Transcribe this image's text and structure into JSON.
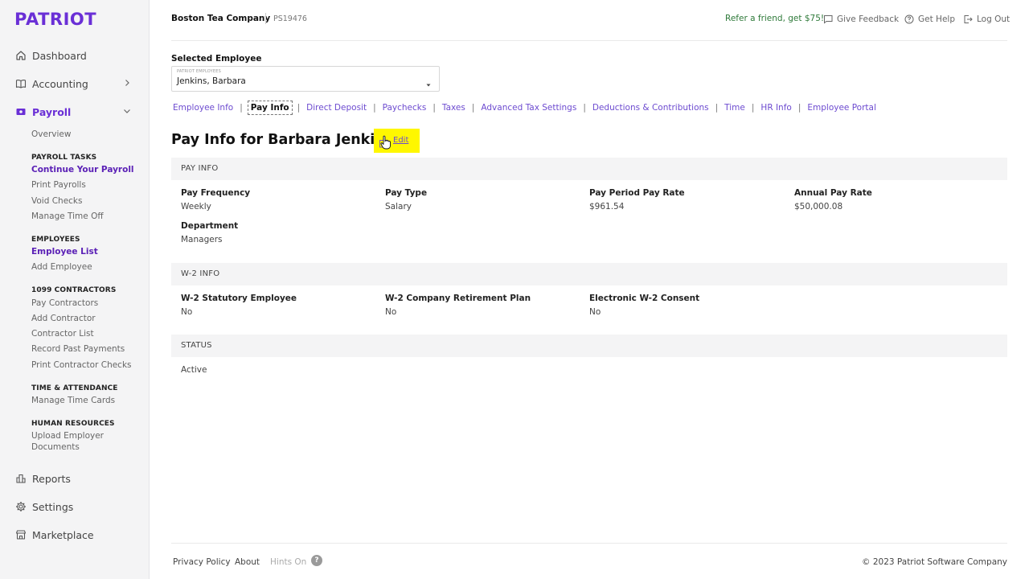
{
  "brand": {
    "logo": "PATRIOT"
  },
  "header": {
    "company": "Boston Tea Company",
    "company_code": "PS19476",
    "refer": "Refer a friend, get $75!",
    "feedback": "Give Feedback",
    "help": "Get Help",
    "logout": "Log Out"
  },
  "sidebar": {
    "dashboard": "Dashboard",
    "accounting": "Accounting",
    "payroll": "Payroll",
    "overview": "Overview",
    "payroll_tasks": {
      "title": "PAYROLL TASKS",
      "items": [
        "Continue Your Payroll",
        "Print Payrolls",
        "Void Checks",
        "Manage Time Off"
      ]
    },
    "employees": {
      "title": "EMPLOYEES",
      "items": [
        "Employee List",
        "Add Employee"
      ]
    },
    "contractors": {
      "title": "1099 CONTRACTORS",
      "items": [
        "Pay Contractors",
        "Add Contractor",
        "Contractor List",
        "Record Past Payments",
        "Print Contractor Checks"
      ]
    },
    "time": {
      "title": "TIME & ATTENDANCE",
      "items": [
        "Manage Time Cards"
      ]
    },
    "hr": {
      "title": "HUMAN RESOURCES",
      "items": [
        "Upload Employer",
        "Documents"
      ]
    },
    "reports": "Reports",
    "settings": "Settings",
    "marketplace": "Marketplace"
  },
  "selector": {
    "label": "Selected Employee",
    "small_label": "PATRIOT EMPLOYEES",
    "value": "Jenkins, Barbara"
  },
  "tabs": [
    "Employee Info",
    "Pay Info",
    "Direct Deposit",
    "Paychecks",
    "Taxes",
    "Advanced Tax Settings",
    "Deductions & Contributions",
    "Time",
    "HR Info",
    "Employee Portal"
  ],
  "page": {
    "title": "Pay Info for Barbara Jenkins",
    "edit": "Edit"
  },
  "pay_info": {
    "heading": "PAY INFO",
    "pay_frequency": {
      "label": "Pay Frequency",
      "value": "Weekly"
    },
    "pay_type": {
      "label": "Pay Type",
      "value": "Salary"
    },
    "period_rate": {
      "label": "Pay Period Pay Rate",
      "value": "$961.54"
    },
    "annual_rate": {
      "label": "Annual Pay Rate",
      "value": "$50,000.08"
    },
    "department": {
      "label": "Department",
      "value": "Managers"
    }
  },
  "w2_info": {
    "heading": "W-2 INFO",
    "statutory": {
      "label": "W-2 Statutory Employee",
      "value": "No"
    },
    "retirement": {
      "label": "W-2 Company Retirement Plan",
      "value": "No"
    },
    "consent": {
      "label": "Electronic W-2 Consent",
      "value": "No"
    }
  },
  "status": {
    "heading": "STATUS",
    "value": "Active"
  },
  "footer": {
    "privacy": "Privacy Policy",
    "about": "About",
    "hints": "Hints On",
    "hints_icon": "?",
    "copyright": "© 2023 Patriot Software Company"
  },
  "colors": {
    "brand": "#6a2fd6",
    "link": "#6d4bd0",
    "refer": "#2f7a3a",
    "highlight": "#fff700"
  }
}
